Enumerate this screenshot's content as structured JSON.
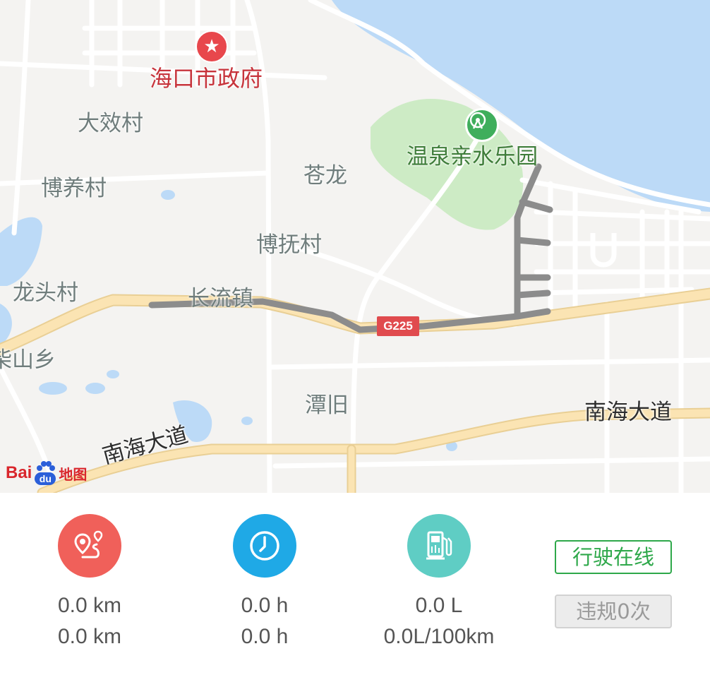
{
  "map": {
    "poi": {
      "government": "海口市政府",
      "park": "温泉亲水乐园"
    },
    "places": {
      "daxiaocun": "大效村",
      "boyangcun": "博养村",
      "canglong": "苍龙",
      "bofucun": "博抚村",
      "longtoucun": "龙头村",
      "changliuzhen": "长流镇",
      "chaishanxiang": "柴山乡",
      "tanjiu": "潭旧"
    },
    "roads": {
      "route_shield": "G225",
      "nanhai_left": "南海大道",
      "nanhai_right": "南海大道"
    },
    "logo": {
      "bai": "Bai",
      "du": "du",
      "ditu": "地图"
    },
    "colors": {
      "water": "#bcdaf7",
      "park": "#cdebc5",
      "road_main": "#fbe4b3",
      "route": "#8c8c8c",
      "gov_marker": "#e8474c",
      "park_marker": "#3fae5c"
    }
  },
  "stats": {
    "distance": {
      "icon": "route-icon",
      "color": "#f0605a",
      "line1": "0.0 km",
      "line2": "0.0 km"
    },
    "duration": {
      "icon": "clock-icon",
      "color": "#1fa9e6",
      "line1": "0.0 h",
      "line2": "0.0 h"
    },
    "fuel": {
      "icon": "fuel-pump-icon",
      "color": "#5fcdc4",
      "line1": "0.0 L",
      "line2": "0.0L/100km"
    }
  },
  "buttons": {
    "online": "行驶在线",
    "violation": "违规0次"
  }
}
